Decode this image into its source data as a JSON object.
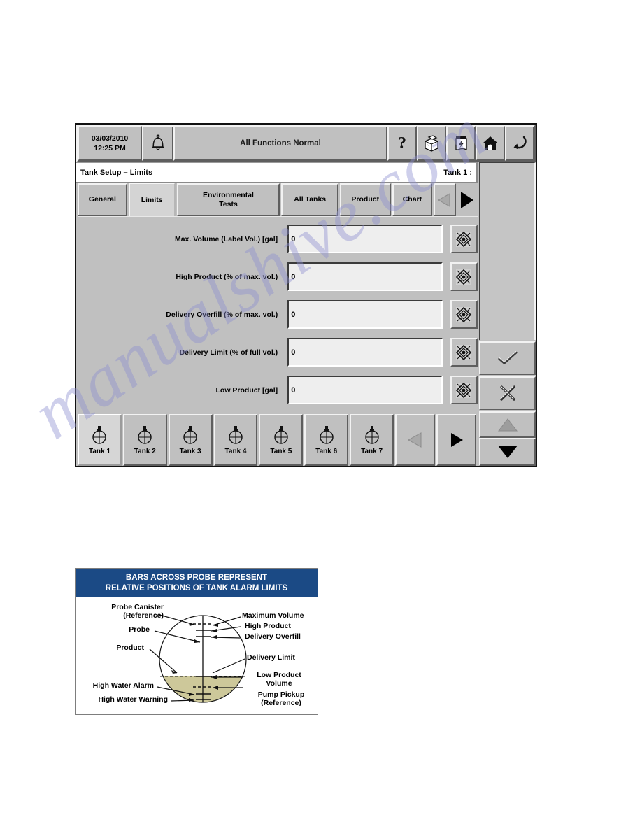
{
  "console": {
    "statusbar": {
      "date": "03/03/2010",
      "time": "12:25 PM",
      "alarm_icon": "bell-icon",
      "status_message": "All Functions Normal",
      "tools": [
        {
          "name": "help-icon",
          "glyph": "?"
        },
        {
          "name": "setup-box-icon",
          "glyph": "box"
        },
        {
          "name": "print-report-icon",
          "glyph": "printer"
        },
        {
          "name": "home-icon",
          "glyph": "home"
        },
        {
          "name": "back-return-icon",
          "glyph": "return"
        }
      ]
    },
    "title": {
      "screen_title": "Tank Setup – Limits",
      "tank_identifier": "Tank 1 :"
    },
    "tabs": [
      {
        "label": "General",
        "active": false
      },
      {
        "label": "Limits",
        "active": true
      },
      {
        "label": "Environmental\nTests",
        "line1": "Environmental",
        "line2": "Tests",
        "active": false
      },
      {
        "label": "All Tanks",
        "active": false
      },
      {
        "label": "Product",
        "active": false
      },
      {
        "label": "Chart",
        "active": false
      }
    ],
    "tab_nav": {
      "prev_label": "previous-tab",
      "prev_enabled": false,
      "next_label": "next-tab",
      "next_enabled": true
    },
    "fields": [
      {
        "label": "Max. Volume (Label Vol.) [gal]",
        "value": "0",
        "keypad": "keypad-icon"
      },
      {
        "label": "High Product (% of max. vol.)",
        "value": "0",
        "keypad": "keypad-icon"
      },
      {
        "label": "Delivery Overfill (% of max. vol.)",
        "value": "0",
        "keypad": "keypad-icon"
      },
      {
        "label": "Delivery Limit (% of full vol.)",
        "value": "0",
        "keypad": "keypad-icon"
      },
      {
        "label": "Low Product [gal]",
        "value": "0",
        "keypad": "keypad-icon"
      }
    ],
    "side_buttons": [
      {
        "name": "accept-button",
        "icon": "check-icon",
        "enabled": true
      },
      {
        "name": "cancel-button",
        "icon": "cross-icon",
        "enabled": true
      },
      {
        "name": "scroll-up-button",
        "icon": "triangle-up-icon",
        "enabled": false
      },
      {
        "name": "scroll-down-button",
        "icon": "triangle-down-icon",
        "enabled": true
      }
    ],
    "tanks": [
      {
        "label": "Tank 1",
        "active": true
      },
      {
        "label": "Tank 2",
        "active": false
      },
      {
        "label": "Tank 3",
        "active": false
      },
      {
        "label": "Tank 4",
        "active": false
      },
      {
        "label": "Tank 5",
        "active": false
      },
      {
        "label": "Tank 6",
        "active": false
      },
      {
        "label": "Tank 7",
        "active": false
      }
    ],
    "tank_nav": {
      "prev_enabled": false,
      "next_enabled": true
    }
  },
  "figure": {
    "header_line1": "BARS ACROSS PROBE REPRESENT",
    "header_line2": "RELATIVE POSITIONS OF TANK ALARM LIMITS",
    "left_labels": [
      {
        "line1": "Probe Canister",
        "line2": "(Reference)"
      },
      {
        "line1": "Probe",
        "line2": ""
      },
      {
        "line1": "Product",
        "line2": ""
      },
      {
        "line1": "High Water Alarm",
        "line2": ""
      },
      {
        "line1": "High Water Warning",
        "line2": ""
      }
    ],
    "right_labels": [
      {
        "line1": "Maximum Volume",
        "line2": ""
      },
      {
        "line1": "High Product",
        "line2": ""
      },
      {
        "line1": "Delivery Overfill",
        "line2": ""
      },
      {
        "line1": "Delivery Limit",
        "line2": ""
      },
      {
        "line1": "Low Product",
        "line2": "Volume"
      },
      {
        "line1": "Pump Pickup",
        "line2": "(Reference)"
      }
    ],
    "colors": {
      "header_blue": "#1b4a85",
      "product_fill": "#cdc89a"
    }
  },
  "watermark": {
    "text": "manualshive.com"
  }
}
